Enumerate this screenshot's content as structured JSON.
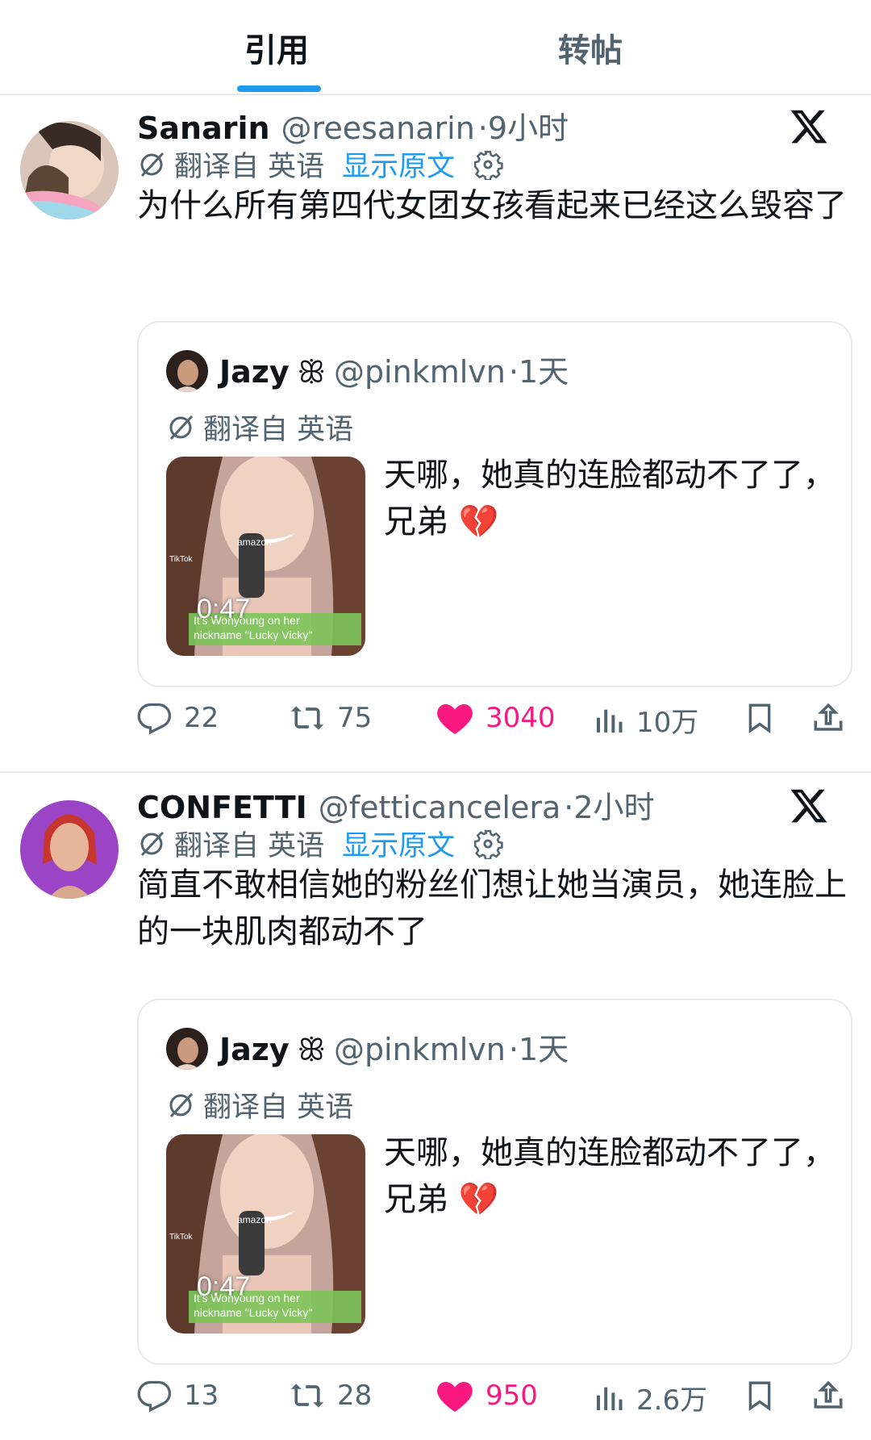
{
  "tabs": [
    {
      "label": "引用",
      "active": true
    },
    {
      "label": "转帖",
      "active": false
    }
  ],
  "posts": [
    {
      "name": "Sanarin",
      "handle": "@reesanarin",
      "time": "·9小时",
      "translated_from": "翻译自 英语",
      "show_original": "显示原文",
      "text": "为什么所有第四代女团女孩看起来已经这么毁容了",
      "quote": {
        "name": "Jazy",
        "badge": "ꕥ",
        "handle": "@pinkmlvn",
        "time": "·1天",
        "translated_from": "翻译自 英语",
        "text": "天哪，她真的连脸都动不了了，兄弟 💔",
        "video_duration": "0:47",
        "video_caption": "It's Wonyoung on her nickname \"Lucky Vicky\"",
        "video_brand": "amazon",
        "video_source": "TikTok"
      },
      "actions": {
        "replies": "22",
        "reposts": "75",
        "likes": "3040",
        "views": "10万"
      }
    },
    {
      "name": "CONFETTI",
      "handle": "@fetticancelera",
      "time": "·2小时",
      "translated_from": "翻译自 英语",
      "show_original": "显示原文",
      "text": "简直不敢相信她的粉丝们想让她当演员，她连脸上的一块肌肉都动不了",
      "quote": {
        "name": "Jazy",
        "badge": "ꕥ",
        "handle": "@pinkmlvn",
        "time": "·1天",
        "translated_from": "翻译自 英语",
        "text": "天哪，她真的连脸都动不了了，兄弟 💔",
        "video_duration": "0:47",
        "video_caption": "It's Wonyoung on her nickname \"Lucky Vicky\"",
        "video_brand": "amazon",
        "video_source": "TikTok"
      },
      "actions": {
        "replies": "13",
        "reposts": "28",
        "likes": "950",
        "views": "2.6万"
      }
    }
  ],
  "colors": {
    "accent": "#1d9bf0",
    "like": "#f91880",
    "muted": "#536471",
    "text": "#0f1419",
    "border": "#e6e9ec"
  },
  "icons": [
    "x-logo-icon",
    "translate-icon",
    "gear-icon",
    "reply-icon",
    "repost-icon",
    "heart-icon",
    "views-icon",
    "bookmark-icon",
    "share-icon"
  ]
}
